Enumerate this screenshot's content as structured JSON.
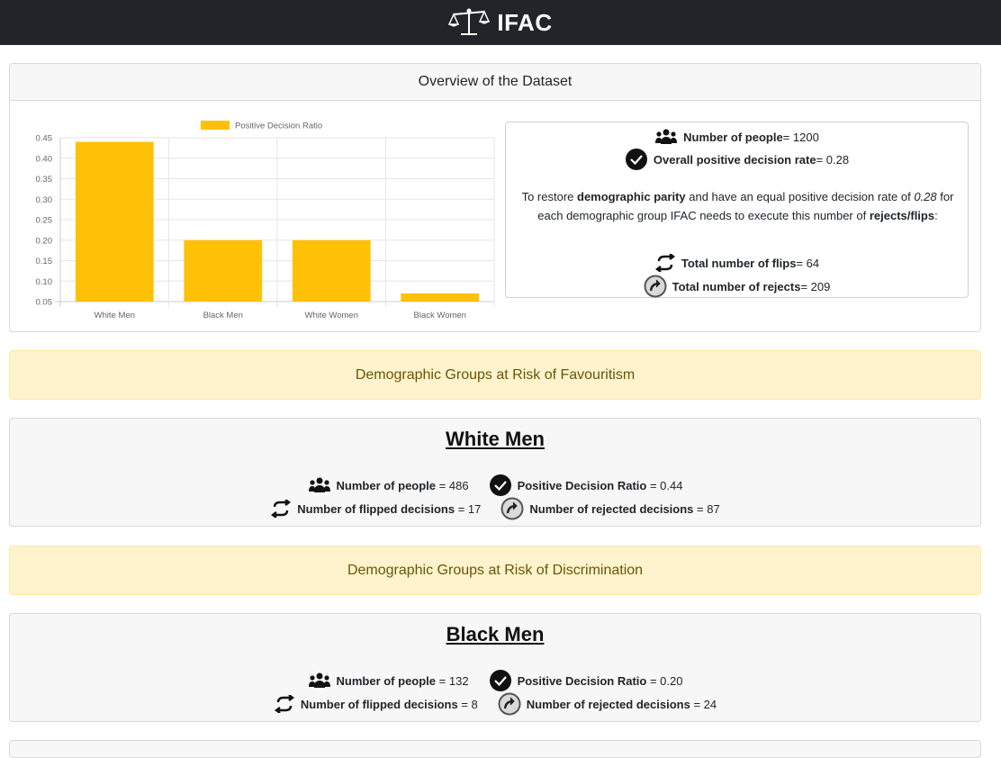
{
  "app": {
    "title": "IFAC"
  },
  "overview": {
    "header": "Overview of the Dataset",
    "stats": {
      "people_label": "Number of people",
      "people_value": "= 1200",
      "rate_label": "Overall positive decision rate",
      "rate_value": "= 0.28",
      "para_part1": "To restore ",
      "para_bold1": "demographic parity",
      "para_part2": " and have an equal positive decision rate of ",
      "para_italic": "0.28",
      "para_part3": " for each demographic group IFAC needs to execute this number of ",
      "para_bold2": "rejects/flips",
      "para_part4": ":",
      "flips_label": "Total number of flips",
      "flips_value": "= 64",
      "rejects_label": "Total number of rejects",
      "rejects_value": "= 209"
    }
  },
  "chart_data": {
    "type": "bar",
    "categories": [
      "White Men",
      "Black Men",
      "White Women",
      "Black Women"
    ],
    "series": [
      {
        "name": "Positive Decision Ratio",
        "values": [
          0.44,
          0.2,
          0.2,
          0.07
        ]
      }
    ],
    "ylim": [
      0.05,
      0.45
    ],
    "yticks": [
      "0.45",
      "0.40",
      "0.35",
      "0.30",
      "0.25",
      "0.20",
      "0.15",
      "0.10",
      "0.05"
    ],
    "ytick_values": [
      0.45,
      0.4,
      0.35,
      0.3,
      0.25,
      0.2,
      0.15,
      0.1,
      0.05
    ],
    "grid": true,
    "legend": "top-center",
    "color": "#ffc107"
  },
  "alerts": {
    "favouritism": "Demographic Groups at Risk of Favouritism",
    "discrimination": "Demographic Groups at Risk of Discrimination"
  },
  "groups": [
    {
      "name": "White Men",
      "people_label": "Number of people",
      "people_value": "= 486",
      "ratio_label": "Positive Decision Ratio",
      "ratio_value": "= 0.44",
      "flipped_label": "Number of flipped decisions",
      "flipped_value": "= 17",
      "rejected_label": "Number of rejected decisions",
      "rejected_value": "= 87"
    },
    {
      "name": "Black Men",
      "people_label": "Number of people",
      "people_value": "= 132",
      "ratio_label": "Positive Decision Ratio",
      "ratio_value": "= 0.20",
      "flipped_label": "Number of flipped decisions",
      "flipped_value": "= 8",
      "rejected_label": "Number of rejected decisions",
      "rejected_value": "= 24"
    }
  ],
  "colors": {
    "navbar": "#212529",
    "accent_bar": "#ffc107",
    "alert_bg": "#fff3cd",
    "alert_text": "#6b5406"
  }
}
